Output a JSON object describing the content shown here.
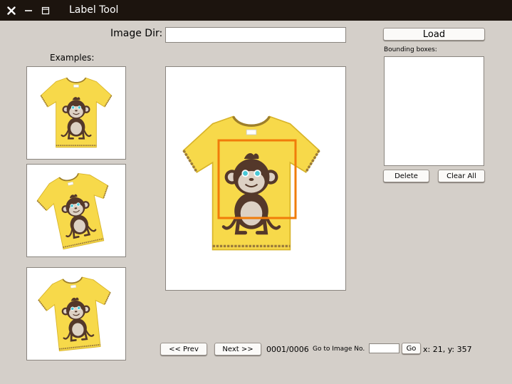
{
  "window": {
    "title": "Label Tool",
    "close_icon": "close-icon",
    "minimize_icon": "minimize-icon",
    "maximize_icon": "maximize-icon"
  },
  "image_dir": {
    "label": "Image Dir:",
    "value": ""
  },
  "load_label": "Load",
  "examples": {
    "label": "Examples:"
  },
  "bounding_boxes": {
    "label": "Bounding boxes:",
    "items": []
  },
  "delete_label": "Delete",
  "clear_all_label": "Clear All",
  "nav": {
    "prev_label": "<< Prev",
    "next_label": "Next >>",
    "progress": "0001/0006",
    "goto_label": "Go to Image No.",
    "goto_value": "",
    "go_label": "Go",
    "cursor_text": "x: 21, y: 357"
  },
  "colors": {
    "titlebar": "#1c140e",
    "background": "#d4cfc9",
    "shirt": "#f7d94a",
    "bbox": "#f07c0a",
    "monkey": "#54382a"
  }
}
